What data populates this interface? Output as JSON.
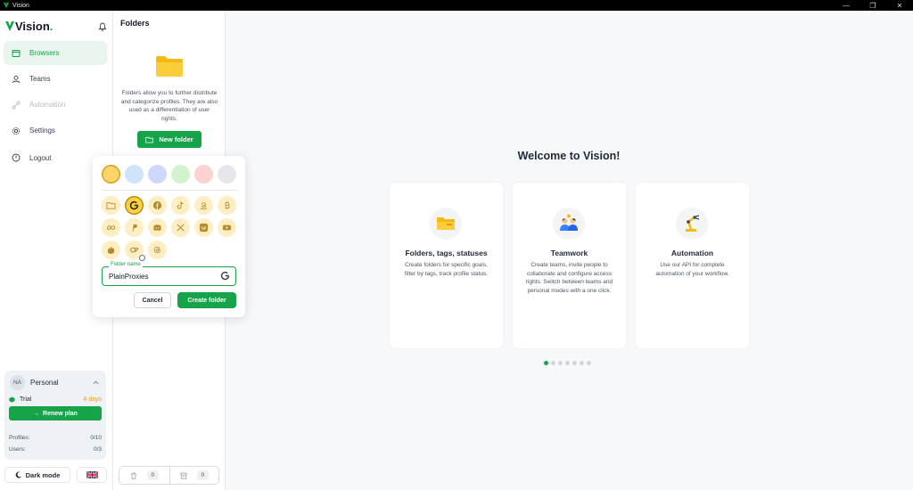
{
  "window": {
    "title": "Vision",
    "controls": [
      "—",
      "❐",
      "✕"
    ]
  },
  "brand": {
    "name": "Vision",
    "dot": "."
  },
  "nav": [
    {
      "label": "Browsers",
      "icon": "browser-icon",
      "active": true
    },
    {
      "label": "Teams",
      "icon": "user-icon"
    },
    {
      "label": "Automation",
      "icon": "automation-icon",
      "disabled": true
    },
    {
      "label": "Settings",
      "icon": "gear-icon"
    }
  ],
  "logout_label": "Logout",
  "plan": {
    "avatar": "NA",
    "name": "Personal",
    "trial_label": "Trial",
    "trial_days": "4 days",
    "renew_label": "Renew plan",
    "profiles_label": "Profiles:",
    "profiles_value": "0/10",
    "users_label": "Users:",
    "users_value": "0/3"
  },
  "dark_mode_label": "Dark mode",
  "folders": {
    "title": "Folders",
    "description": "Folders allow you to further distribute and categorize profiles. They are also used as a differentiation of user rights.",
    "new_folder_label": "New folder",
    "footer": {
      "trash_count": "0",
      "archive_count": "0"
    }
  },
  "popup": {
    "colors": [
      "#fcd56a",
      "#cfe3fb",
      "#cfd7fb",
      "#d3f2cf",
      "#fbd2d2",
      "#e5e7eb"
    ],
    "icons": [
      [
        "folder-icon",
        "google-icon",
        "facebook-icon",
        "tiktok-icon",
        "amazon-icon",
        "bitcoin-icon"
      ],
      [
        "meta-icon",
        "paypal-icon",
        "discord-icon",
        "x-icon",
        "vk-icon",
        "youtube-icon"
      ],
      [
        "tinder-icon",
        "onlyfans-icon",
        "threads-icon"
      ]
    ],
    "field_label": "Folder name",
    "field_value": "PlainProxies",
    "cancel_label": "Cancel",
    "create_label": "Create folder"
  },
  "main": {
    "title": "Welcome to Vision!",
    "cards": [
      {
        "title": "Folders, tags, statuses",
        "text": "Create folders for specific goals, filter by tags, track profile status."
      },
      {
        "title": "Teamwork",
        "text": "Create teams, invite people to collaborate and configure access rights. Switch between teams and personal modes with a one click."
      },
      {
        "title": "Automation",
        "text": "Use our API for complete automation of your workflow."
      }
    ],
    "dots": 7,
    "active_dot": 0
  }
}
